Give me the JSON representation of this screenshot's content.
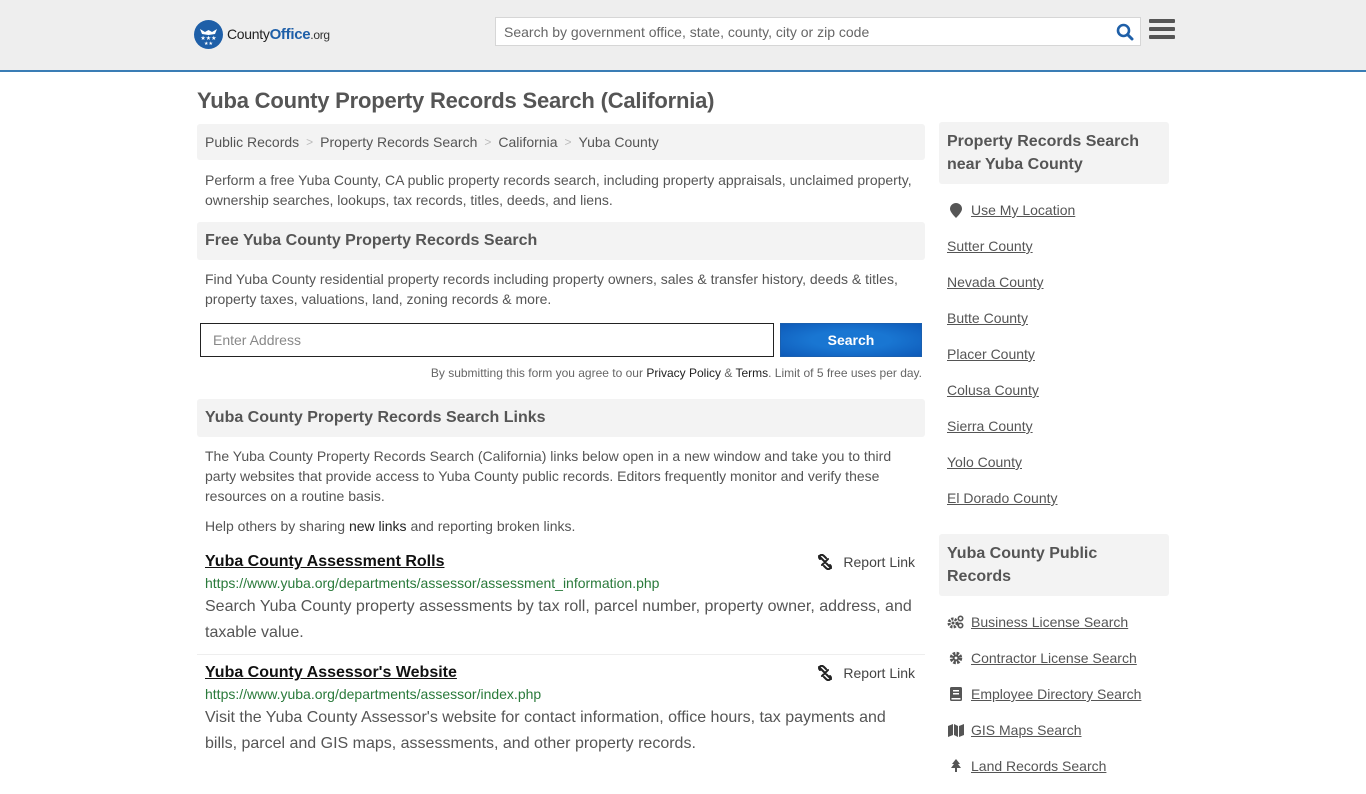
{
  "header": {
    "logo": {
      "county": "County",
      "office": "Office",
      "org": ".org"
    },
    "search_placeholder": "Search by government office, state, county, city or zip code",
    "accent_color": "#3a7db5"
  },
  "page_title": "Yuba County Property Records Search (California)",
  "breadcrumb": [
    {
      "label": "Public Records"
    },
    {
      "label": "Property Records Search"
    },
    {
      "label": "California"
    },
    {
      "label": "Yuba County"
    }
  ],
  "intro": "Perform a free Yuba County, CA public property records search, including property appraisals, unclaimed property, ownership searches, lookups, tax records, titles, deeds, and liens.",
  "free_search": {
    "heading": "Free Yuba County Property Records Search",
    "description": "Find Yuba County residential property records including property owners, sales & transfer history, deeds & titles, property taxes, valuations, land, zoning records & more.",
    "address_placeholder": "Enter Address",
    "button_label": "Search",
    "disclaimer_prefix": "By submitting this form you agree to our ",
    "privacy_label": "Privacy Policy",
    "amp": " & ",
    "terms_label": "Terms",
    "disclaimer_suffix": ". Limit of 5 free uses per day."
  },
  "links_section": {
    "heading": "Yuba County Property Records Search Links",
    "description": "The Yuba County Property Records Search (California) links below open in a new window and take you to third party websites that provide access to Yuba County public records. Editors frequently monitor and verify these resources on a routine basis.",
    "help_prefix": "Help others by sharing ",
    "help_link": "new links",
    "help_suffix": " and reporting broken links.",
    "report_label": "Report Link",
    "items": [
      {
        "title": "Yuba County Assessment Rolls",
        "url": "https://www.yuba.org/departments/assessor/assessment_information.php",
        "description": "Search Yuba County property assessments by tax roll, parcel number, property owner, address, and taxable value."
      },
      {
        "title": "Yuba County Assessor's Website",
        "url": "https://www.yuba.org/departments/assessor/index.php",
        "description": "Visit the Yuba County Assessor's website for contact information, office hours, tax payments and bills, parcel and GIS maps, assessments, and other property records."
      }
    ]
  },
  "sidebar": {
    "nearby": {
      "heading": "Property Records Search near Yuba County",
      "use_location": "Use My Location",
      "counties": [
        "Sutter County",
        "Nevada County",
        "Butte County",
        "Placer County",
        "Colusa County",
        "Sierra County",
        "Yolo County",
        "El Dorado County"
      ]
    },
    "public_records": {
      "heading": "Yuba County Public Records",
      "items": [
        {
          "label": "Business License Search",
          "icon": "cogs-icon"
        },
        {
          "label": "Contractor License Search",
          "icon": "gear-icon"
        },
        {
          "label": "Employee Directory Search",
          "icon": "book-icon"
        },
        {
          "label": "GIS Maps Search",
          "icon": "map-icon"
        },
        {
          "label": "Land Records Search",
          "icon": "tree-icon"
        }
      ]
    }
  }
}
